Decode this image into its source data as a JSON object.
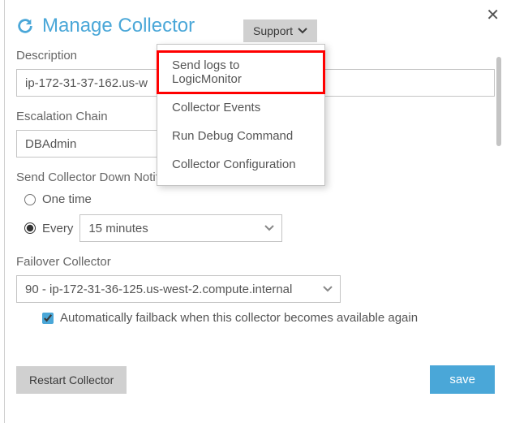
{
  "header": {
    "title": "Manage Collector",
    "support_label": "Support"
  },
  "support_menu": {
    "items": [
      {
        "label": "Send logs to LogicMonitor",
        "highlighted": true
      },
      {
        "label": "Collector Events",
        "highlighted": false
      },
      {
        "label": "Run Debug Command",
        "highlighted": false
      },
      {
        "label": "Collector Configuration",
        "highlighted": false
      }
    ]
  },
  "description": {
    "label": "Description",
    "value": "ip-172-31-37-162.us-w"
  },
  "escalation": {
    "label": "Escalation Chain",
    "value": "DBAdmin"
  },
  "notifications": {
    "label": "Send Collector Down Notifications",
    "one_time_label": "One time",
    "every_label": "Every",
    "interval_value": "15 minutes",
    "selected": "every"
  },
  "failover": {
    "label": "Failover Collector",
    "value": "90 - ip-172-31-36-125.us-west-2.compute.internal",
    "auto_failback_label": "Automatically failback when this collector becomes available again",
    "auto_failback_checked": true
  },
  "footer": {
    "restart_label": "Restart Collector",
    "save_label": "save"
  }
}
